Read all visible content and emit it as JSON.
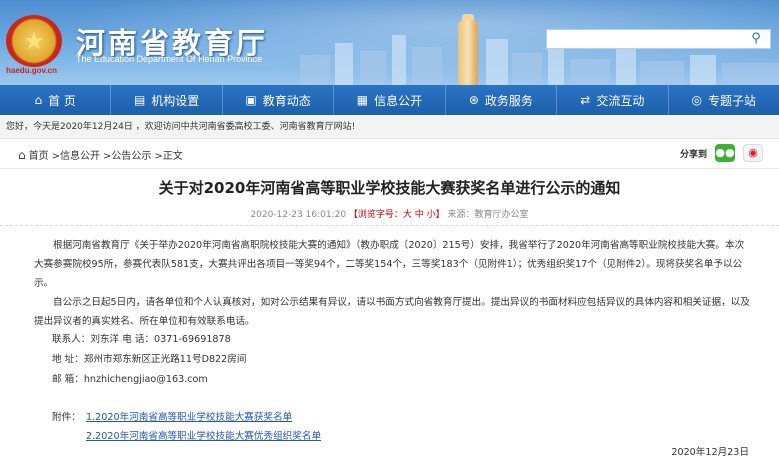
{
  "header": {
    "site_title": "河南省教育厅",
    "site_title_en": "The Education Department Of Henan Province",
    "domain": "haedu.gov.cn",
    "search_placeholder": ""
  },
  "nav": [
    {
      "label": "首 页",
      "icon": "home-icon",
      "glyph": "⌂"
    },
    {
      "label": "机构设置",
      "icon": "org-icon",
      "glyph": "▤"
    },
    {
      "label": "教育动态",
      "icon": "news-icon",
      "glyph": "▣"
    },
    {
      "label": "信息公开",
      "icon": "info-icon",
      "glyph": "▦"
    },
    {
      "label": "政务服务",
      "icon": "service-icon",
      "glyph": "⊛"
    },
    {
      "label": "交流互动",
      "icon": "interact-icon",
      "glyph": "⇄"
    },
    {
      "label": "专题子站",
      "icon": "topic-icon",
      "glyph": "◎"
    }
  ],
  "welcome": "您好，今天是2020年12月24日 ，欢迎访问中共河南省委高校工委、河南省教育厅网站!",
  "breadcrumb": {
    "home": "首页",
    "items": [
      ">信息公开",
      ">公告公示",
      ">正文"
    ],
    "share_label": "分享到"
  },
  "article": {
    "title": "关于对2020年河南省高等职业学校技能大赛获奖名单进行公示的通知",
    "meta_date": "2020-12-23 16:01:20",
    "meta_font": "【浏览字号：大 中 小】",
    "meta_source": "来源：教育厅办公室",
    "para1": "根据河南省教育厅《关于举办2020年河南省高职院校技能大赛的通知》（教办职成〔2020〕215号）安排，我省举行了2020年河南省高等职业院校技能大赛。本次大赛参赛院校95所，参赛代表队581支，大赛共评出各项目一等奖94个，二等奖154个，三等奖183个（见附件1）；优秀组织奖17个（见附件2）。现将获奖名单予以公示。",
    "para2": "自公示之日起5日内，请各单位和个人认真核对，如对公示结果有异议，请以书面方式向省教育厅提出。提出异议的书面材料应包括异议的具体内容和相关证据，以及提出异议者的真实姓名、所在单位和有效联系电话。",
    "contact": "联系人：刘东洋      电  话：0371-69691878",
    "address": "地   址：郑州市郑东新区正光路11号D822房间",
    "email": "邮   箱：hnzhichengjiao@163.com",
    "attach_label": "附件：",
    "attachments": [
      "1.2020年河南省高等职业学校技能大赛获奖名单",
      "2.2020年河南省高等职业学校技能大赛优秀组织奖名单"
    ],
    "sign_date": "2020年12月23日"
  }
}
